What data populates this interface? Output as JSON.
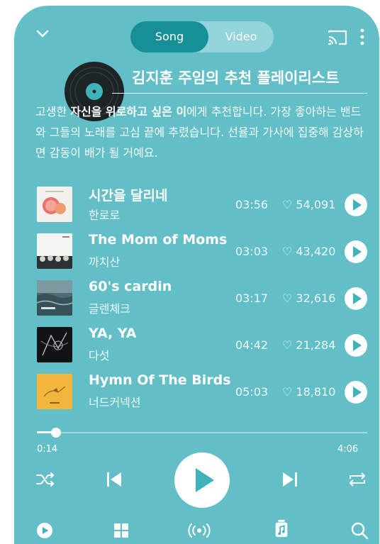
{
  "header": {
    "tabs": [
      {
        "label": "Song",
        "active": true
      },
      {
        "label": "Video",
        "active": false
      }
    ]
  },
  "playlist": {
    "title": "김지훈 주임의 추천 플레이리스트",
    "description_parts": [
      {
        "text": "고생한 ",
        "bold": false
      },
      {
        "text": "자신을 위로하고 싶은 이",
        "bold": true
      },
      {
        "text": "에게 추천합니다. 가장 좋아하는 밴드와 그들의 노래를 고심 끝에 추렸습니다. 선율과 가사에 집중해 감상하면 감동이 배가 될 거예요.",
        "bold": false
      }
    ]
  },
  "tracks": [
    {
      "title": "시간을 달리네",
      "artist": "한로로",
      "duration": "03:56",
      "likes": "♡ 54,091",
      "art": "grapefruit"
    },
    {
      "title": "The Mom of Moms",
      "artist": "까치산",
      "duration": "03:03",
      "likes": "♡ 43,420",
      "art": "band-photo"
    },
    {
      "title": "60's cardin",
      "artist": "글렌체크",
      "duration": "03:17",
      "likes": "♡ 32,616",
      "art": "ocean"
    },
    {
      "title": "YA, YA",
      "artist": "다섯",
      "duration": "04:42",
      "likes": "♡ 21,284",
      "art": "dark-sketch"
    },
    {
      "title": "Hymn Of The Birds",
      "artist": "너드커넥션",
      "duration": "05:03",
      "likes": "♡ 18,810",
      "art": "yellow-bird"
    }
  ],
  "player": {
    "current_time": "0:14",
    "total_time": "4:06",
    "progress": 0.057
  },
  "icons": {
    "top_left": "chevron-down-icon",
    "cast": "cast-icon",
    "more": "more-vertical-icon",
    "shuffle": "shuffle-icon",
    "previous": "skip-previous-icon",
    "play": "play-icon",
    "next": "skip-next-icon",
    "repeat": "repeat-icon",
    "nav": [
      "play-circle-icon",
      "grid-icon",
      "radio-icon",
      "music-library-icon",
      "search-icon"
    ]
  },
  "colors": {
    "background": "#63bfc7",
    "accent": "#168f96",
    "toggle_track": "#93d4da"
  }
}
